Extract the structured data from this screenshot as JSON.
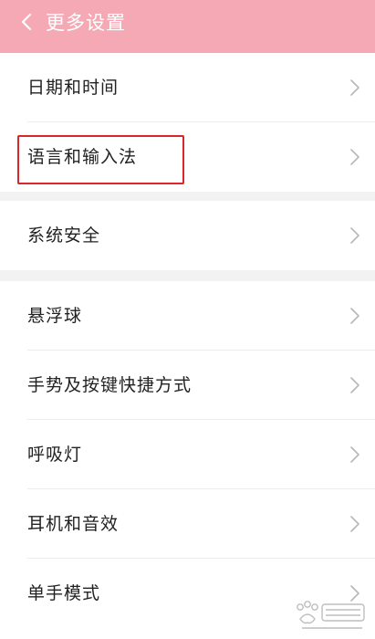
{
  "header": {
    "title": "更多设置",
    "back_icon": "chevron-left-icon",
    "background_color": "#f5a9b4"
  },
  "settings": {
    "items": [
      {
        "label": "日期和时间",
        "icon": "chevron-right-icon"
      },
      {
        "label": "语言和输入法",
        "icon": "chevron-right-icon",
        "highlighted": true
      },
      {
        "label": "系统安全",
        "icon": "chevron-right-icon"
      },
      {
        "label": "悬浮球",
        "icon": "chevron-right-icon"
      },
      {
        "label": "手势及按键快捷方式",
        "icon": "chevron-right-icon"
      },
      {
        "label": "呼吸灯",
        "icon": "chevron-right-icon"
      },
      {
        "label": "耳机和音效",
        "icon": "chevron-right-icon"
      },
      {
        "label": "单手模式",
        "icon": "chevron-right-icon"
      }
    ]
  },
  "annotation": {
    "highlight_color": "#d9262b"
  },
  "watermark": {
    "logo": "baidu-jingyan-logo"
  }
}
